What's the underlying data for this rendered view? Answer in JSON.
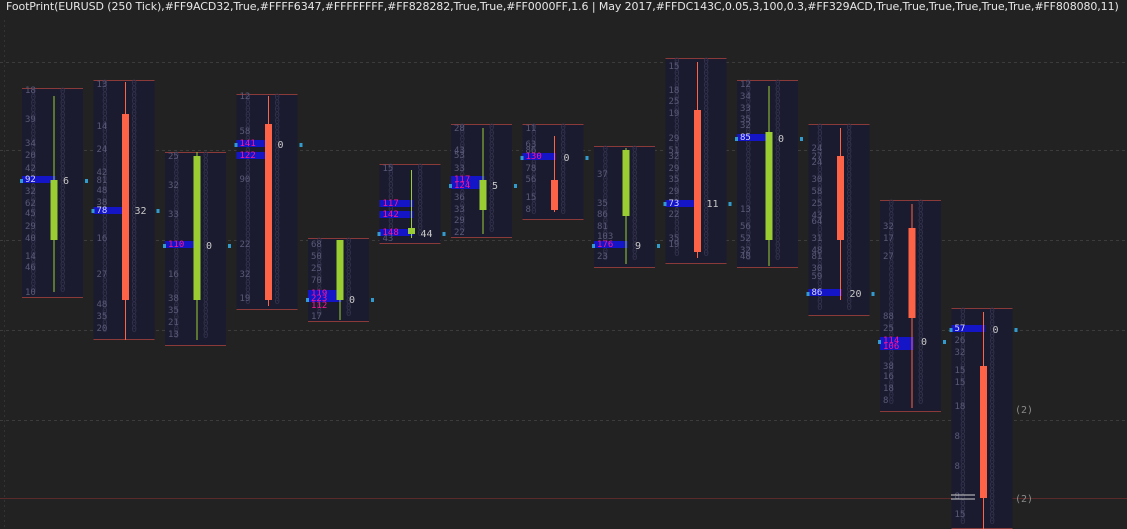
{
  "header": {
    "text": "FootPrint(EURUSD (250 Tick),#FF9ACD32,True,#FFFF6347,#FFFFFFFF,#FF828282,True,True,#FF0000FF,1.6 | May 2017,#FFDC143C,0.05,3,100,0.3,#FF329ACD,True,True,True,True,True,True,#FF808080,11)"
  },
  "colors": {
    "background": "#222222",
    "up": "#9ACD32",
    "down": "#FF6347",
    "cluster_bg": "#1B1B30",
    "volume_high": "#1515C8",
    "poc": "#FF1493",
    "number": "#5A5A78",
    "border": "#8B3A3A",
    "delta_marker": "#329ACD",
    "grid": "#3C3C3C",
    "level_line": "#5A2A2A"
  },
  "chart_data": {
    "type": "footprint",
    "title": "FootPrint(EURUSD (250 Tick)",
    "ylim": [
      0,
      529
    ],
    "grid": true,
    "bars": [
      {
        "open": 180,
        "close": 240,
        "high": 96,
        "low": 292,
        "top": 88,
        "bottom": 298,
        "dir": "up",
        "labels": [
          {
            "y": 92,
            "t": "18"
          },
          {
            "y": 121,
            "t": "39"
          },
          {
            "y": 145,
            "t": "34"
          },
          {
            "y": 157,
            "t": "20"
          },
          {
            "y": 170,
            "t": "42"
          },
          {
            "y": 181,
            "t": "92",
            "hl": true
          },
          {
            "y": 193,
            "t": "32"
          },
          {
            "y": 205,
            "t": "62"
          },
          {
            "y": 215,
            "t": "45"
          },
          {
            "y": 228,
            "t": "29"
          },
          {
            "y": 240,
            "t": "40"
          },
          {
            "y": 258,
            "t": "14"
          },
          {
            "y": 269,
            "t": "46"
          },
          {
            "y": 294,
            "t": "10"
          }
        ],
        "poc": {
          "y": 181,
          "t": "92",
          "delta": "6"
        }
      },
      {
        "open": 114,
        "close": 300,
        "high": 82,
        "low": 340,
        "top": 80,
        "bottom": 340,
        "dir": "down",
        "labels": [
          {
            "y": 86,
            "t": "13"
          },
          {
            "y": 128,
            "t": "14"
          },
          {
            "y": 151,
            "t": "24"
          },
          {
            "y": 174,
            "t": "42"
          },
          {
            "y": 182,
            "t": "81"
          },
          {
            "y": 192,
            "t": "48"
          },
          {
            "y": 204,
            "t": "38"
          },
          {
            "y": 212,
            "t": "78",
            "hl": true
          },
          {
            "y": 240,
            "t": "16"
          },
          {
            "y": 276,
            "t": "27"
          },
          {
            "y": 306,
            "t": "48"
          },
          {
            "y": 318,
            "t": "35"
          },
          {
            "y": 330,
            "t": "20"
          }
        ],
        "poc": {
          "y": 211,
          "t": "78",
          "delta": "32"
        }
      },
      {
        "open": 300,
        "close": 156,
        "high": 152,
        "low": 340,
        "top": 152,
        "bottom": 346,
        "dir": "up",
        "labels": [
          {
            "y": 158,
            "t": "25"
          },
          {
            "y": 187,
            "t": "32"
          },
          {
            "y": 216,
            "t": "33"
          },
          {
            "y": 246,
            "t": "110",
            "hl": true,
            "poc": true
          },
          {
            "y": 276,
            "t": "16"
          },
          {
            "y": 300,
            "t": "38"
          },
          {
            "y": 312,
            "t": "35"
          },
          {
            "y": 324,
            "t": "21"
          },
          {
            "y": 336,
            "t": "13"
          }
        ],
        "poc": {
          "y": 246,
          "t": "110",
          "delta": "0"
        }
      },
      {
        "open": 124,
        "close": 300,
        "high": 96,
        "low": 306,
        "top": 94,
        "bottom": 310,
        "dir": "down",
        "labels": [
          {
            "y": 98,
            "t": "12"
          },
          {
            "y": 133,
            "t": "58"
          },
          {
            "y": 145,
            "t": "141",
            "hl": true,
            "poc": true
          },
          {
            "y": 157,
            "t": "122",
            "hl": true,
            "poc": true
          },
          {
            "y": 181,
            "t": "90"
          },
          {
            "y": 246,
            "t": "22"
          },
          {
            "y": 276,
            "t": "32"
          },
          {
            "y": 300,
            "t": "19"
          }
        ],
        "poc": {
          "y": 145,
          "t": "141",
          "delta": "0"
        }
      },
      {
        "open": 300,
        "close": 240,
        "high": 240,
        "low": 320,
        "top": 238,
        "bottom": 322,
        "dir": "up",
        "labels": [
          {
            "y": 246,
            "t": "68"
          },
          {
            "y": 258,
            "t": "50"
          },
          {
            "y": 270,
            "t": "25"
          },
          {
            "y": 282,
            "t": "70"
          },
          {
            "y": 295,
            "t": "119",
            "hl": true,
            "poc": true
          },
          {
            "y": 300,
            "t": "223",
            "hl": true,
            "poc": true
          },
          {
            "y": 307,
            "t": "112",
            "poc": true
          },
          {
            "y": 318,
            "t": "17"
          }
        ],
        "poc": {
          "y": 300,
          "t": "223",
          "delta": "0"
        }
      },
      {
        "open": 234,
        "close": 228,
        "high": 170,
        "low": 238,
        "top": 164,
        "bottom": 244,
        "dir": "up",
        "labels": [
          {
            "y": 170,
            "t": "15"
          },
          {
            "y": 205,
            "t": "117",
            "hl": true,
            "poc": true
          },
          {
            "y": 216,
            "t": "142",
            "hl": true,
            "poc": true
          },
          {
            "y": 234,
            "t": "148",
            "hl": true,
            "poc": true
          },
          {
            "y": 240,
            "t": "43"
          }
        ],
        "poc": {
          "y": 234,
          "t": "148",
          "delta": "44"
        }
      },
      {
        "open": 210,
        "close": 180,
        "high": 128,
        "low": 234,
        "top": 124,
        "bottom": 238,
        "dir": "up",
        "labels": [
          {
            "y": 130,
            "t": "28"
          },
          {
            "y": 152,
            "t": "43"
          },
          {
            "y": 157,
            "t": "53"
          },
          {
            "y": 170,
            "t": "33"
          },
          {
            "y": 181,
            "t": "117",
            "hl": true,
            "poc": true
          },
          {
            "y": 187,
            "t": "124",
            "hl": true,
            "poc": true
          },
          {
            "y": 199,
            "t": "36"
          },
          {
            "y": 211,
            "t": "33"
          },
          {
            "y": 222,
            "t": "29"
          },
          {
            "y": 234,
            "t": "22"
          }
        ],
        "poc": {
          "y": 186,
          "t": "117",
          "delta": "5"
        }
      },
      {
        "open": 180,
        "close": 210,
        "high": 136,
        "low": 212,
        "top": 124,
        "bottom": 220,
        "dir": "down",
        "labels": [
          {
            "y": 130,
            "t": "11"
          },
          {
            "y": 146,
            "t": "63"
          },
          {
            "y": 152,
            "t": "86"
          },
          {
            "y": 158,
            "t": "130",
            "hl": true,
            "poc": true
          },
          {
            "y": 170,
            "t": "78"
          },
          {
            "y": 181,
            "t": "56"
          },
          {
            "y": 199,
            "t": "15"
          },
          {
            "y": 211,
            "t": "8"
          }
        ],
        "poc": {
          "y": 158,
          "t": "130",
          "delta": "0"
        }
      },
      {
        "open": 216,
        "close": 150,
        "high": 148,
        "low": 264,
        "top": 146,
        "bottom": 268,
        "dir": "up",
        "labels": [
          {
            "y": 176,
            "t": "37"
          },
          {
            "y": 205,
            "t": "35"
          },
          {
            "y": 216,
            "t": "86"
          },
          {
            "y": 228,
            "t": "81"
          },
          {
            "y": 238,
            "t": "103"
          },
          {
            "y": 246,
            "t": "176",
            "hl": true,
            "poc": true
          },
          {
            "y": 258,
            "t": "23"
          }
        ],
        "poc": {
          "y": 246,
          "t": "176",
          "delta": "9"
        }
      },
      {
        "open": 110,
        "close": 252,
        "high": 62,
        "low": 258,
        "top": 58,
        "bottom": 264,
        "dir": "down",
        "labels": [
          {
            "y": 68,
            "t": "15"
          },
          {
            "y": 92,
            "t": "18"
          },
          {
            "y": 103,
            "t": "25"
          },
          {
            "y": 115,
            "t": "19"
          },
          {
            "y": 140,
            "t": "29"
          },
          {
            "y": 152,
            "t": "51"
          },
          {
            "y": 158,
            "t": "32"
          },
          {
            "y": 170,
            "t": "29"
          },
          {
            "y": 181,
            "t": "35"
          },
          {
            "y": 193,
            "t": "29"
          },
          {
            "y": 205,
            "t": "73",
            "hl": true
          },
          {
            "y": 216,
            "t": "22"
          },
          {
            "y": 240,
            "t": "35"
          },
          {
            "y": 246,
            "t": "19"
          }
        ],
        "poc": {
          "y": 204,
          "t": "73",
          "delta": "11"
        }
      },
      {
        "open": 240,
        "close": 132,
        "high": 86,
        "low": 266,
        "top": 80,
        "bottom": 268,
        "dir": "up",
        "labels": [
          {
            "y": 86,
            "t": "12"
          },
          {
            "y": 98,
            "t": "34"
          },
          {
            "y": 110,
            "t": "33"
          },
          {
            "y": 121,
            "t": "35"
          },
          {
            "y": 127,
            "t": "32"
          },
          {
            "y": 139,
            "t": "85",
            "hl": true
          },
          {
            "y": 211,
            "t": "13"
          },
          {
            "y": 228,
            "t": "56"
          },
          {
            "y": 240,
            "t": "52"
          },
          {
            "y": 252,
            "t": "32"
          },
          {
            "y": 258,
            "t": "48"
          }
        ],
        "poc": {
          "y": 139,
          "t": "85",
          "delta": "0"
        }
      },
      {
        "open": 156,
        "close": 240,
        "high": 128,
        "low": 300,
        "top": 124,
        "bottom": 316,
        "dir": "down",
        "labels": [
          {
            "y": 150,
            "t": "24"
          },
          {
            "y": 158,
            "t": "27"
          },
          {
            "y": 164,
            "t": "24"
          },
          {
            "y": 181,
            "t": "30"
          },
          {
            "y": 193,
            "t": "58"
          },
          {
            "y": 205,
            "t": "25"
          },
          {
            "y": 217,
            "t": "43"
          },
          {
            "y": 223,
            "t": "64"
          },
          {
            "y": 240,
            "t": "31"
          },
          {
            "y": 252,
            "t": "48"
          },
          {
            "y": 258,
            "t": "81"
          },
          {
            "y": 270,
            "t": "30"
          },
          {
            "y": 278,
            "t": "59"
          },
          {
            "y": 294,
            "t": "86",
            "hl": true
          }
        ],
        "poc": {
          "y": 294,
          "t": "86",
          "delta": "20"
        }
      },
      {
        "open": 228,
        "close": 318,
        "high": 204,
        "low": 408,
        "top": 200,
        "bottom": 412,
        "dir": "down",
        "labels": [
          {
            "y": 228,
            "t": "32"
          },
          {
            "y": 240,
            "t": "17"
          },
          {
            "y": 258,
            "t": "27"
          },
          {
            "y": 318,
            "t": "88"
          },
          {
            "y": 330,
            "t": "25"
          },
          {
            "y": 342,
            "t": "114",
            "hl": true,
            "poc": true
          },
          {
            "y": 348,
            "t": "106",
            "hl": true,
            "poc": true
          },
          {
            "y": 368,
            "t": "38"
          },
          {
            "y": 378,
            "t": "16"
          },
          {
            "y": 390,
            "t": "18"
          },
          {
            "y": 402,
            "t": "8"
          }
        ],
        "poc": {
          "y": 342,
          "t": "114",
          "delta": "0"
        }
      },
      {
        "open": 366,
        "close": 498,
        "high": 312,
        "low": 529,
        "top": 308,
        "bottom": 529,
        "dir": "down",
        "labels": [
          {
            "y": 330,
            "t": "57",
            "hl": true
          },
          {
            "y": 342,
            "t": "26"
          },
          {
            "y": 354,
            "t": "32"
          },
          {
            "y": 372,
            "t": "15"
          },
          {
            "y": 384,
            "t": "15"
          },
          {
            "y": 408,
            "t": "18"
          },
          {
            "y": 438,
            "t": "8"
          },
          {
            "y": 468,
            "t": "8"
          },
          {
            "y": 498,
            "t": "8"
          },
          {
            "y": 516,
            "t": "15"
          }
        ],
        "poc": {
          "y": 330,
          "t": "57",
          "delta": "0"
        }
      }
    ],
    "annotations": [
      {
        "y": 409,
        "t": "(2)"
      },
      {
        "y": 498,
        "t": "(2)"
      }
    ]
  }
}
